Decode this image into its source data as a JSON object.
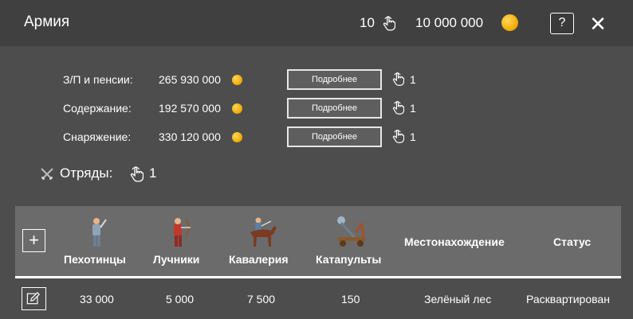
{
  "header": {
    "title": "Армия",
    "actions_count": "10",
    "gold": "10 000 000",
    "help_label": "?",
    "close_label": "✕"
  },
  "expenses": [
    {
      "label": "З/П и пенсии:",
      "value": "265 930 000",
      "button": "Подробнее",
      "count": "1"
    },
    {
      "label": "Содержание:",
      "value": "192 570 000",
      "button": "Подробнее",
      "count": "1"
    },
    {
      "label": "Снаряжение:",
      "value": "330 120 000",
      "button": "Подробнее",
      "count": "1"
    }
  ],
  "squads": {
    "label": "Отряды:",
    "count": "1"
  },
  "table": {
    "add_label": "+",
    "columns": [
      "Пехотинцы",
      "Лучники",
      "Кавалерия",
      "Катапульты",
      "Местонахождение",
      "Статус"
    ],
    "rows": [
      {
        "infantry": "33 000",
        "archers": "5 000",
        "cavalry": "7 500",
        "catapults": "150",
        "location": "Зелёный лес",
        "status": "Расквартирован"
      }
    ]
  },
  "icons": {
    "hand": "hand-click-icon",
    "coin": "gold-coin-icon",
    "swords": "crossed-swords-icon",
    "edit": "edit-icon"
  },
  "colors": {
    "coin": "#f0a800",
    "header_bg": "#404040",
    "body_bg": "#4d4d4d",
    "table_head_bg": "#6b6b6b"
  }
}
